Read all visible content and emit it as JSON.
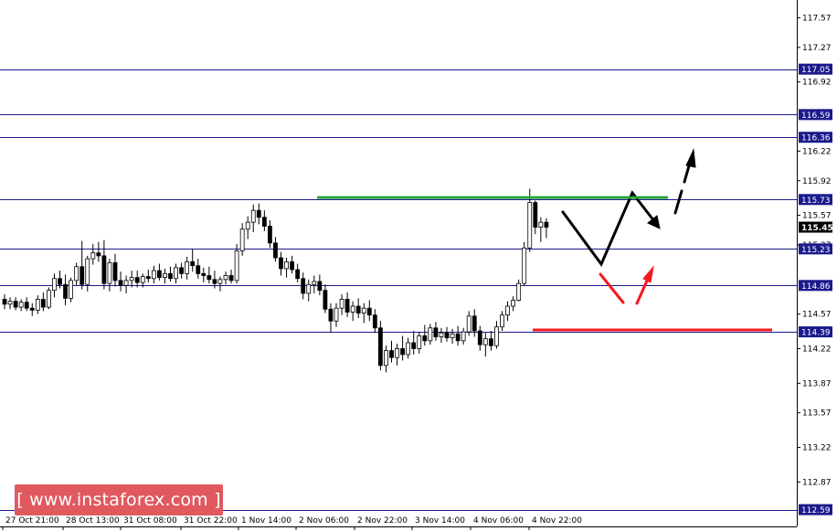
{
  "chart_data": {
    "type": "candlestick",
    "title": "",
    "xlabel": "",
    "ylabel": "",
    "ylim": [
      112.42,
      117.75
    ],
    "grid": false,
    "y_ticks": [
      "117.57",
      "117.27",
      "116.92",
      "116.22",
      "115.92",
      "115.57",
      "115.27",
      "114.57",
      "114.22",
      "113.87",
      "113.57",
      "113.22",
      "112.87"
    ],
    "x_ticks": [
      "27 Oct 21:00",
      "28 Oct 13:00",
      "31 Oct 08:00",
      "31 Oct 22:00",
      "1 Nov 14:00",
      "2 Nov 06:00",
      "2 Nov 22:00",
      "3 Nov 14:00",
      "4 Nov 06:00",
      "4 Nov 22:00"
    ],
    "levels": [
      {
        "value": 117.05,
        "label": "117.05"
      },
      {
        "value": 116.59,
        "label": "116.59"
      },
      {
        "value": 116.36,
        "label": "116.36"
      },
      {
        "value": 115.73,
        "label": "115.73"
      },
      {
        "value": 115.23,
        "label": "115.23"
      },
      {
        "value": 114.86,
        "label": "114.86"
      },
      {
        "value": 114.39,
        "label": "114.39"
      },
      {
        "value": 112.59,
        "label": "112.59"
      }
    ],
    "current_price": {
      "value": 115.45,
      "label": "115.45"
    },
    "resistance_line": {
      "value": 115.75,
      "color": "#22a335",
      "x_from": "2 Nov 06:00",
      "x_to": "5 Nov 12:00"
    },
    "support_line": {
      "value": 114.41,
      "color": "#f4191e",
      "x_from": "4 Nov 22:00",
      "x_to": "6 Nov 12:00"
    },
    "candles": [
      {
        "o": 114.72,
        "h": 114.77,
        "l": 114.62,
        "c": 114.67
      },
      {
        "o": 114.67,
        "h": 114.74,
        "l": 114.62,
        "c": 114.7
      },
      {
        "o": 114.7,
        "h": 114.74,
        "l": 114.61,
        "c": 114.64
      },
      {
        "o": 114.64,
        "h": 114.72,
        "l": 114.6,
        "c": 114.69
      },
      {
        "o": 114.69,
        "h": 114.74,
        "l": 114.6,
        "c": 114.63
      },
      {
        "o": 114.63,
        "h": 114.68,
        "l": 114.55,
        "c": 114.61
      },
      {
        "o": 114.61,
        "h": 114.76,
        "l": 114.57,
        "c": 114.72
      },
      {
        "o": 114.72,
        "h": 114.79,
        "l": 114.6,
        "c": 114.64
      },
      {
        "o": 114.64,
        "h": 114.84,
        "l": 114.62,
        "c": 114.81
      },
      {
        "o": 114.81,
        "h": 114.98,
        "l": 114.74,
        "c": 114.93
      },
      {
        "o": 114.93,
        "h": 115.01,
        "l": 114.83,
        "c": 114.87
      },
      {
        "o": 114.87,
        "h": 114.97,
        "l": 114.66,
        "c": 114.73
      },
      {
        "o": 114.73,
        "h": 114.94,
        "l": 114.69,
        "c": 114.91
      },
      {
        "o": 114.91,
        "h": 115.09,
        "l": 114.86,
        "c": 115.05
      },
      {
        "o": 115.05,
        "h": 115.31,
        "l": 114.82,
        "c": 114.87
      },
      {
        "o": 114.87,
        "h": 115.16,
        "l": 114.8,
        "c": 115.13
      },
      {
        "o": 115.13,
        "h": 115.28,
        "l": 115.07,
        "c": 115.19
      },
      {
        "o": 115.19,
        "h": 115.3,
        "l": 115.1,
        "c": 115.16
      },
      {
        "o": 115.16,
        "h": 115.32,
        "l": 114.82,
        "c": 114.88
      },
      {
        "o": 114.88,
        "h": 115.13,
        "l": 114.8,
        "c": 115.09
      },
      {
        "o": 115.09,
        "h": 115.18,
        "l": 114.85,
        "c": 114.91
      },
      {
        "o": 114.91,
        "h": 115.0,
        "l": 114.8,
        "c": 114.86
      },
      {
        "o": 114.86,
        "h": 114.96,
        "l": 114.78,
        "c": 114.91
      },
      {
        "o": 114.91,
        "h": 115.01,
        "l": 114.84,
        "c": 114.94
      },
      {
        "o": 114.94,
        "h": 115.01,
        "l": 114.84,
        "c": 114.89
      },
      {
        "o": 114.89,
        "h": 114.98,
        "l": 114.84,
        "c": 114.95
      },
      {
        "o": 114.95,
        "h": 115.02,
        "l": 114.89,
        "c": 114.93
      },
      {
        "o": 114.93,
        "h": 115.06,
        "l": 114.88,
        "c": 115.01
      },
      {
        "o": 115.01,
        "h": 115.08,
        "l": 114.91,
        "c": 114.94
      },
      {
        "o": 114.94,
        "h": 115.03,
        "l": 114.88,
        "c": 114.98
      },
      {
        "o": 114.98,
        "h": 115.05,
        "l": 114.9,
        "c": 114.93
      },
      {
        "o": 114.93,
        "h": 115.08,
        "l": 114.88,
        "c": 115.04
      },
      {
        "o": 115.04,
        "h": 115.09,
        "l": 114.93,
        "c": 114.98
      },
      {
        "o": 114.98,
        "h": 115.15,
        "l": 114.92,
        "c": 115.1
      },
      {
        "o": 115.1,
        "h": 115.23,
        "l": 115.0,
        "c": 115.06
      },
      {
        "o": 115.06,
        "h": 115.13,
        "l": 114.93,
        "c": 114.98
      },
      {
        "o": 114.98,
        "h": 115.04,
        "l": 114.89,
        "c": 114.96
      },
      {
        "o": 114.96,
        "h": 115.05,
        "l": 114.88,
        "c": 114.92
      },
      {
        "o": 114.92,
        "h": 115.01,
        "l": 114.83,
        "c": 114.88
      },
      {
        "o": 114.88,
        "h": 114.95,
        "l": 114.8,
        "c": 114.92
      },
      {
        "o": 114.92,
        "h": 115.0,
        "l": 114.87,
        "c": 114.96
      },
      {
        "o": 114.96,
        "h": 115.02,
        "l": 114.88,
        "c": 114.91
      },
      {
        "o": 114.91,
        "h": 115.28,
        "l": 114.88,
        "c": 115.21
      },
      {
        "o": 115.21,
        "h": 115.49,
        "l": 115.16,
        "c": 115.43
      },
      {
        "o": 115.43,
        "h": 115.56,
        "l": 115.33,
        "c": 115.5
      },
      {
        "o": 115.5,
        "h": 115.68,
        "l": 115.4,
        "c": 115.62
      },
      {
        "o": 115.62,
        "h": 115.69,
        "l": 115.48,
        "c": 115.55
      },
      {
        "o": 115.55,
        "h": 115.62,
        "l": 115.41,
        "c": 115.46
      },
      {
        "o": 115.46,
        "h": 115.52,
        "l": 115.24,
        "c": 115.29
      },
      {
        "o": 115.29,
        "h": 115.35,
        "l": 115.1,
        "c": 115.14
      },
      {
        "o": 115.14,
        "h": 115.2,
        "l": 114.96,
        "c": 115.03
      },
      {
        "o": 115.03,
        "h": 115.14,
        "l": 114.94,
        "c": 115.1
      },
      {
        "o": 115.1,
        "h": 115.16,
        "l": 114.98,
        "c": 115.02
      },
      {
        "o": 115.02,
        "h": 115.08,
        "l": 114.89,
        "c": 114.93
      },
      {
        "o": 114.93,
        "h": 114.99,
        "l": 114.72,
        "c": 114.78
      },
      {
        "o": 114.78,
        "h": 114.92,
        "l": 114.7,
        "c": 114.87
      },
      {
        "o": 114.87,
        "h": 114.96,
        "l": 114.78,
        "c": 114.9
      },
      {
        "o": 114.9,
        "h": 114.97,
        "l": 114.76,
        "c": 114.81
      },
      {
        "o": 114.81,
        "h": 114.87,
        "l": 114.58,
        "c": 114.62
      },
      {
        "o": 114.62,
        "h": 114.68,
        "l": 114.38,
        "c": 114.5
      },
      {
        "o": 114.5,
        "h": 114.68,
        "l": 114.44,
        "c": 114.63
      },
      {
        "o": 114.63,
        "h": 114.77,
        "l": 114.56,
        "c": 114.72
      },
      {
        "o": 114.72,
        "h": 114.79,
        "l": 114.54,
        "c": 114.59
      },
      {
        "o": 114.59,
        "h": 114.7,
        "l": 114.5,
        "c": 114.65
      },
      {
        "o": 114.65,
        "h": 114.73,
        "l": 114.53,
        "c": 114.58
      },
      {
        "o": 114.58,
        "h": 114.68,
        "l": 114.48,
        "c": 114.63
      },
      {
        "o": 114.63,
        "h": 114.71,
        "l": 114.5,
        "c": 114.56
      },
      {
        "o": 114.56,
        "h": 114.62,
        "l": 114.38,
        "c": 114.43
      },
      {
        "o": 114.43,
        "h": 114.5,
        "l": 114.0,
        "c": 114.05
      },
      {
        "o": 114.05,
        "h": 114.25,
        "l": 113.98,
        "c": 114.2
      },
      {
        "o": 114.2,
        "h": 114.3,
        "l": 114.08,
        "c": 114.13
      },
      {
        "o": 114.13,
        "h": 114.27,
        "l": 114.05,
        "c": 114.22
      },
      {
        "o": 114.22,
        "h": 114.35,
        "l": 114.1,
        "c": 114.16
      },
      {
        "o": 114.16,
        "h": 114.33,
        "l": 114.12,
        "c": 114.28
      },
      {
        "o": 114.28,
        "h": 114.4,
        "l": 114.16,
        "c": 114.22
      },
      {
        "o": 114.22,
        "h": 114.39,
        "l": 114.17,
        "c": 114.35
      },
      {
        "o": 114.35,
        "h": 114.46,
        "l": 114.25,
        "c": 114.3
      },
      {
        "o": 114.3,
        "h": 114.47,
        "l": 114.26,
        "c": 114.43
      },
      {
        "o": 114.43,
        "h": 114.49,
        "l": 114.3,
        "c": 114.34
      },
      {
        "o": 114.34,
        "h": 114.43,
        "l": 114.28,
        "c": 114.38
      },
      {
        "o": 114.38,
        "h": 114.44,
        "l": 114.29,
        "c": 114.33
      },
      {
        "o": 114.33,
        "h": 114.42,
        "l": 114.27,
        "c": 114.37
      },
      {
        "o": 114.37,
        "h": 114.45,
        "l": 114.25,
        "c": 114.3
      },
      {
        "o": 114.3,
        "h": 114.43,
        "l": 114.26,
        "c": 114.39
      },
      {
        "o": 114.39,
        "h": 114.6,
        "l": 114.35,
        "c": 114.55
      },
      {
        "o": 114.55,
        "h": 114.62,
        "l": 114.34,
        "c": 114.4
      },
      {
        "o": 114.4,
        "h": 114.45,
        "l": 114.2,
        "c": 114.26
      },
      {
        "o": 114.26,
        "h": 114.38,
        "l": 114.14,
        "c": 114.32
      },
      {
        "o": 114.32,
        "h": 114.4,
        "l": 114.2,
        "c": 114.25
      },
      {
        "o": 114.25,
        "h": 114.5,
        "l": 114.22,
        "c": 114.44
      },
      {
        "o": 114.44,
        "h": 114.6,
        "l": 114.4,
        "c": 114.56
      },
      {
        "o": 114.56,
        "h": 114.7,
        "l": 114.5,
        "c": 114.65
      },
      {
        "o": 114.65,
        "h": 114.75,
        "l": 114.6,
        "c": 114.71
      },
      {
        "o": 114.71,
        "h": 114.92,
        "l": 114.7,
        "c": 114.88
      },
      {
        "o": 114.88,
        "h": 115.3,
        "l": 114.86,
        "c": 115.24
      },
      {
        "o": 115.24,
        "h": 115.84,
        "l": 115.2,
        "c": 115.7
      },
      {
        "o": 115.7,
        "h": 115.72,
        "l": 115.38,
        "c": 115.45
      },
      {
        "o": 115.45,
        "h": 115.55,
        "l": 115.3,
        "c": 115.5
      },
      {
        "o": 115.5,
        "h": 115.54,
        "l": 115.34,
        "c": 115.45
      }
    ]
  },
  "watermark": {
    "text": "[ www.instaforex.com ]"
  }
}
